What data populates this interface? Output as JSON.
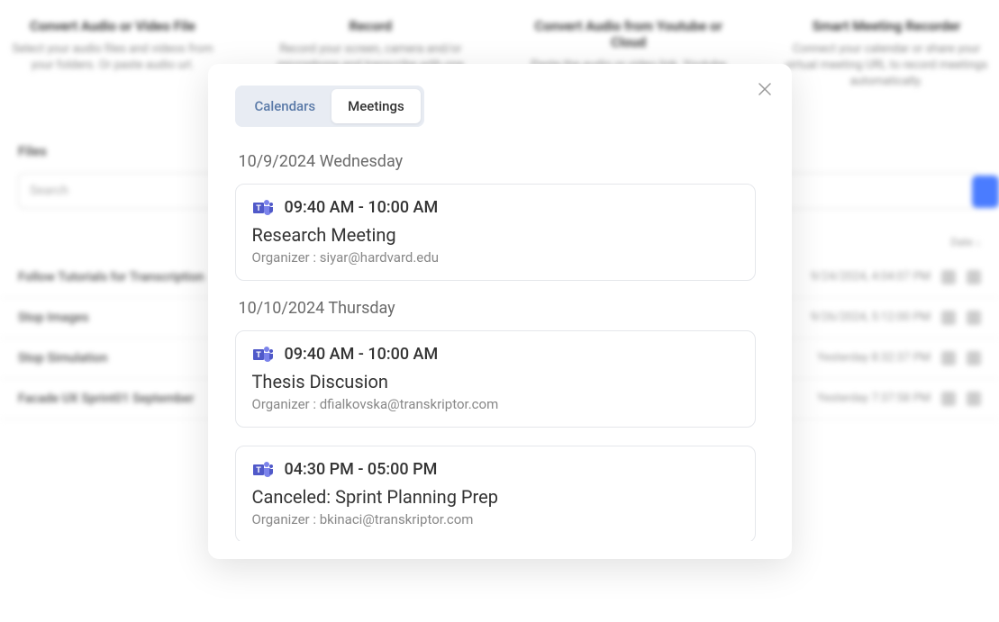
{
  "background": {
    "cards": [
      {
        "title": "Convert Audio or Video File",
        "desc": "Select your audio files and videos from your folders. Or paste audio url."
      },
      {
        "title": "Record",
        "desc": "Record your screen, camera and/or microphone and transcribe with one click."
      },
      {
        "title": "Convert Audio from Youtube or Cloud",
        "desc": "Paste the audio or video link. Youtube link or file links through shared cloud services."
      },
      {
        "title": "Smart Meeting Recorder",
        "desc": "Connect your calendar or share your virtual meeting URL to record meetings automatically."
      }
    ],
    "section_title": "Files",
    "search_placeholder": "Search",
    "list_header_right": "Date ↓",
    "rows": [
      {
        "name": "Follow Tutorials for Transcription",
        "date": "9/24/2024, 4:04:07 PM"
      },
      {
        "name": "Stop Images",
        "date": "9/26/2024, 5:12:00 PM"
      },
      {
        "name": "Stop Simulation",
        "date": "Yesterday 8:32:37 PM"
      },
      {
        "name": "Facade UX Sprint01 September",
        "date": "Yesterday 7:37:58 PM"
      }
    ]
  },
  "modal": {
    "tabs": {
      "calendars": "Calendars",
      "meetings": "Meetings"
    },
    "days": [
      {
        "header": "10/9/2024 Wednesday",
        "meetings": [
          {
            "time": "09:40 AM - 10:00 AM",
            "title": "Research Meeting",
            "organizer_label": "Organizer : ",
            "organizer": "siyar@hardvard.edu"
          }
        ]
      },
      {
        "header": "10/10/2024 Thursday",
        "meetings": [
          {
            "time": "09:40 AM - 10:00 AM",
            "title": "Thesis Discusion",
            "organizer_label": "Organizer : ",
            "organizer": "dfialkovska@transkriptor.com"
          },
          {
            "time": "04:30 PM - 05:00 PM",
            "title": "Canceled: Sprint Planning Prep",
            "organizer_label": "Organizer : ",
            "organizer": "bkinaci@transkriptor.com"
          }
        ]
      }
    ]
  }
}
